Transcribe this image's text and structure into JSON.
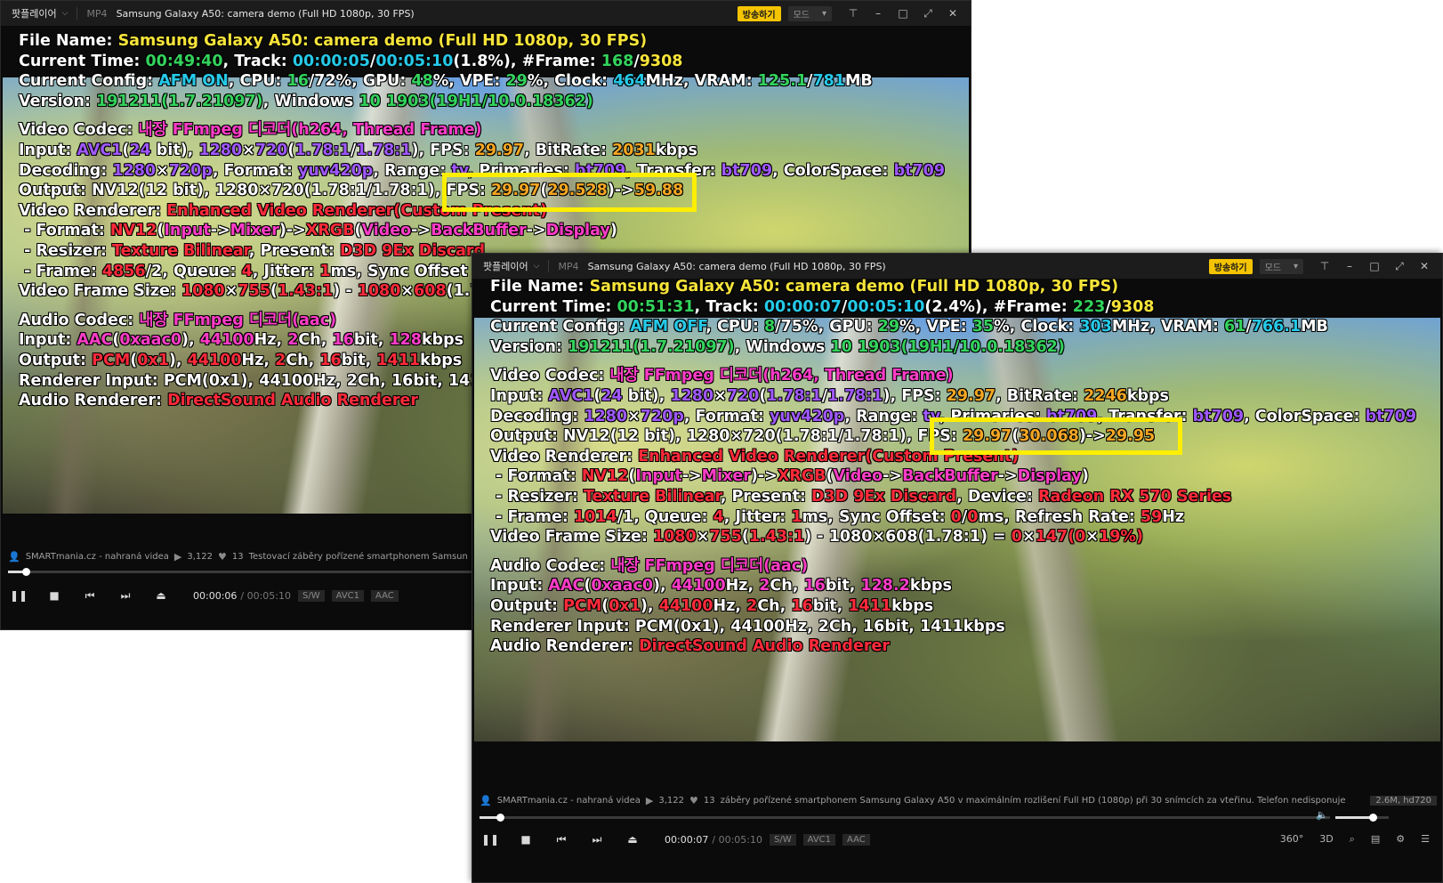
{
  "windows": [
    {
      "app_name": "팟플레이어",
      "format": "MP4",
      "title": "Samsung Galaxy A50: camera demo (Full HD 1080p, 30 FPS)",
      "broadcast_label": "방송하기",
      "mode_label": "모드",
      "osd": {
        "file_name_label": "File Name: ",
        "file_name": "Samsung Galaxy A50: camera demo (Full HD 1080p, 30 FPS)",
        "current_time": "00:49:40",
        "track_pos": "00:00:05",
        "track_len": "00:05:10",
        "track_pct": "(1.8%)",
        "frame": "168",
        "frame_total": "9308",
        "afm": "AFM ON",
        "cpu": "16",
        "cpu2": "72",
        "gpu": "48",
        "vpe": "29",
        "clock": "464",
        "vram": "125.1",
        "vram_total": "781",
        "version": "191211",
        "version_b": "(1.7.21097)",
        "windows_ver": "10 1903",
        "windows_build": "(19H1/10.0.18362)",
        "bitrate": "2031",
        "output_fps": "29.97",
        "output_fps_measured": "29.528",
        "output_fps_target": "59.88",
        "frame_count": "4856",
        "frame_div": "/2",
        "queue": "4",
        "jitter": "1",
        "audio_bitrate": "128",
        "output_kbps": "1411"
      },
      "infobar": {
        "channel": "SMARTmania.cz - nahraná videa",
        "views": "3,122",
        "count": "13",
        "desc": "Testovací záběry pořízené smartphonem Samsun"
      },
      "controls": {
        "time": "00:00:06",
        "duration": "/ 00:05:10",
        "tags": [
          "S/W",
          "AVC1",
          "AAC"
        ]
      },
      "progress_fraction": 0.019
    },
    {
      "app_name": "팟플레이어",
      "format": "MP4",
      "title": "Samsung Galaxy A50: camera demo (Full HD 1080p, 30 FPS)",
      "broadcast_label": "방송하기",
      "mode_label": "모드",
      "osd": {
        "file_name_label": "File Name: ",
        "file_name": "Samsung Galaxy A50: camera demo (Full HD 1080p, 30 FPS)",
        "current_time": "00:51:31",
        "track_pos": "00:00:07",
        "track_len": "00:05:10",
        "track_pct": "(2.4%)",
        "frame": "223",
        "frame_total": "9308",
        "afm": "AFM OFF",
        "cpu": "8",
        "cpu2": "75",
        "gpu": "29",
        "vpe": "35",
        "clock": "303",
        "vram": "61",
        "vram_total": "766.1",
        "version": "191211",
        "version_b": "(1.7.21097)",
        "windows_ver": "10 1903",
        "windows_build": "(19H1/10.0.18362)",
        "bitrate": "2246",
        "output_fps": "29.97",
        "output_fps_measured": "30.068",
        "output_fps_target": "29.95",
        "frame_count": "1014",
        "frame_div": "/1",
        "queue": "4",
        "jitter": "1",
        "sync": "0",
        "sync2": "0",
        "refresh": "59",
        "device": "Radeon RX 570 Series",
        "frame_size_diff": "0",
        "frame_size_diff2": "147",
        "frame_size_pct": "(0",
        "frame_size_pct2": "19",
        "audio_bitrate": "128.2",
        "output_kbps": "1411"
      },
      "infobar": {
        "channel": "SMARTmania.cz - nahraná videa",
        "views": "3,122",
        "count": "13",
        "desc": "záběry pořízené smartphonem Samsung Galaxy A50 v maximálním rozlišení Full HD (1080p) při 30 snímcích za vteřinu. Telefon nedisponuje",
        "quality": "2.6M, hd720"
      },
      "controls": {
        "time": "00:00:07",
        "duration": "/ 00:05:10",
        "tags": [
          "S/W",
          "AVC1",
          "AAC"
        ],
        "right_icons": [
          "360°",
          "3D"
        ]
      },
      "progress_fraction": 0.024,
      "volume_fraction": 0.7
    }
  ]
}
